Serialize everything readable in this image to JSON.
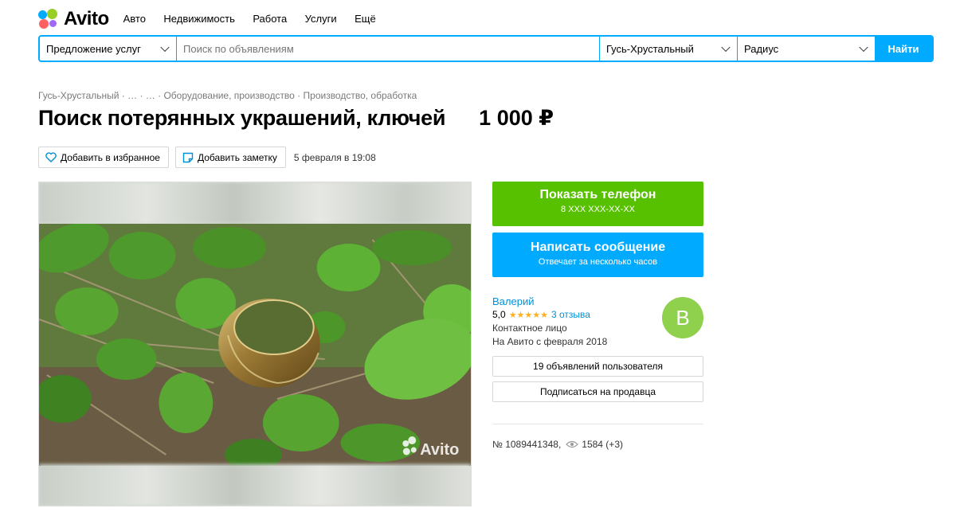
{
  "brand": {
    "name": "Avito",
    "colors": {
      "accent": "#00aaff",
      "green": "#57c100",
      "link": "#0091d9"
    }
  },
  "nav": [
    {
      "label": "Авто"
    },
    {
      "label": "Недвижимость"
    },
    {
      "label": "Работа"
    },
    {
      "label": "Услуги"
    },
    {
      "label": "Ещё"
    }
  ],
  "search": {
    "category": "Предложение услуг",
    "placeholder": "Поиск по объявлениям",
    "city": "Гусь-Хрустальный",
    "radius": "Радиус",
    "button": "Найти"
  },
  "breadcrumb": "Гусь-Хрустальный · … · … · Оборудование, производство · Производство, обработка",
  "listing": {
    "title": "Поиск потерянных украшений, ключей",
    "price": "1 000 ₽",
    "favorite_label": "Добавить в избранное",
    "note_label": "Добавить заметку",
    "date": "5 февраля в 19:08",
    "photo_watermark": "Avito",
    "number": "№ 1089441348,",
    "views": "1584 (+3)"
  },
  "contact": {
    "phone_label": "Показать телефон",
    "phone_masked": "8 XXX XXX-XX-XX",
    "message_label": "Написать сообщение",
    "message_sub": "Отвечает за несколько часов"
  },
  "seller": {
    "name": "Валерий",
    "rating": "5,0",
    "stars": "★★★★★",
    "reviews": "3 отзыва",
    "type": "Контактное лицо",
    "since": "На Авито с февраля 2018",
    "avatar_letter": "В",
    "listings_button": "19 объявлений пользователя",
    "subscribe_button": "Подписаться на продавца"
  }
}
